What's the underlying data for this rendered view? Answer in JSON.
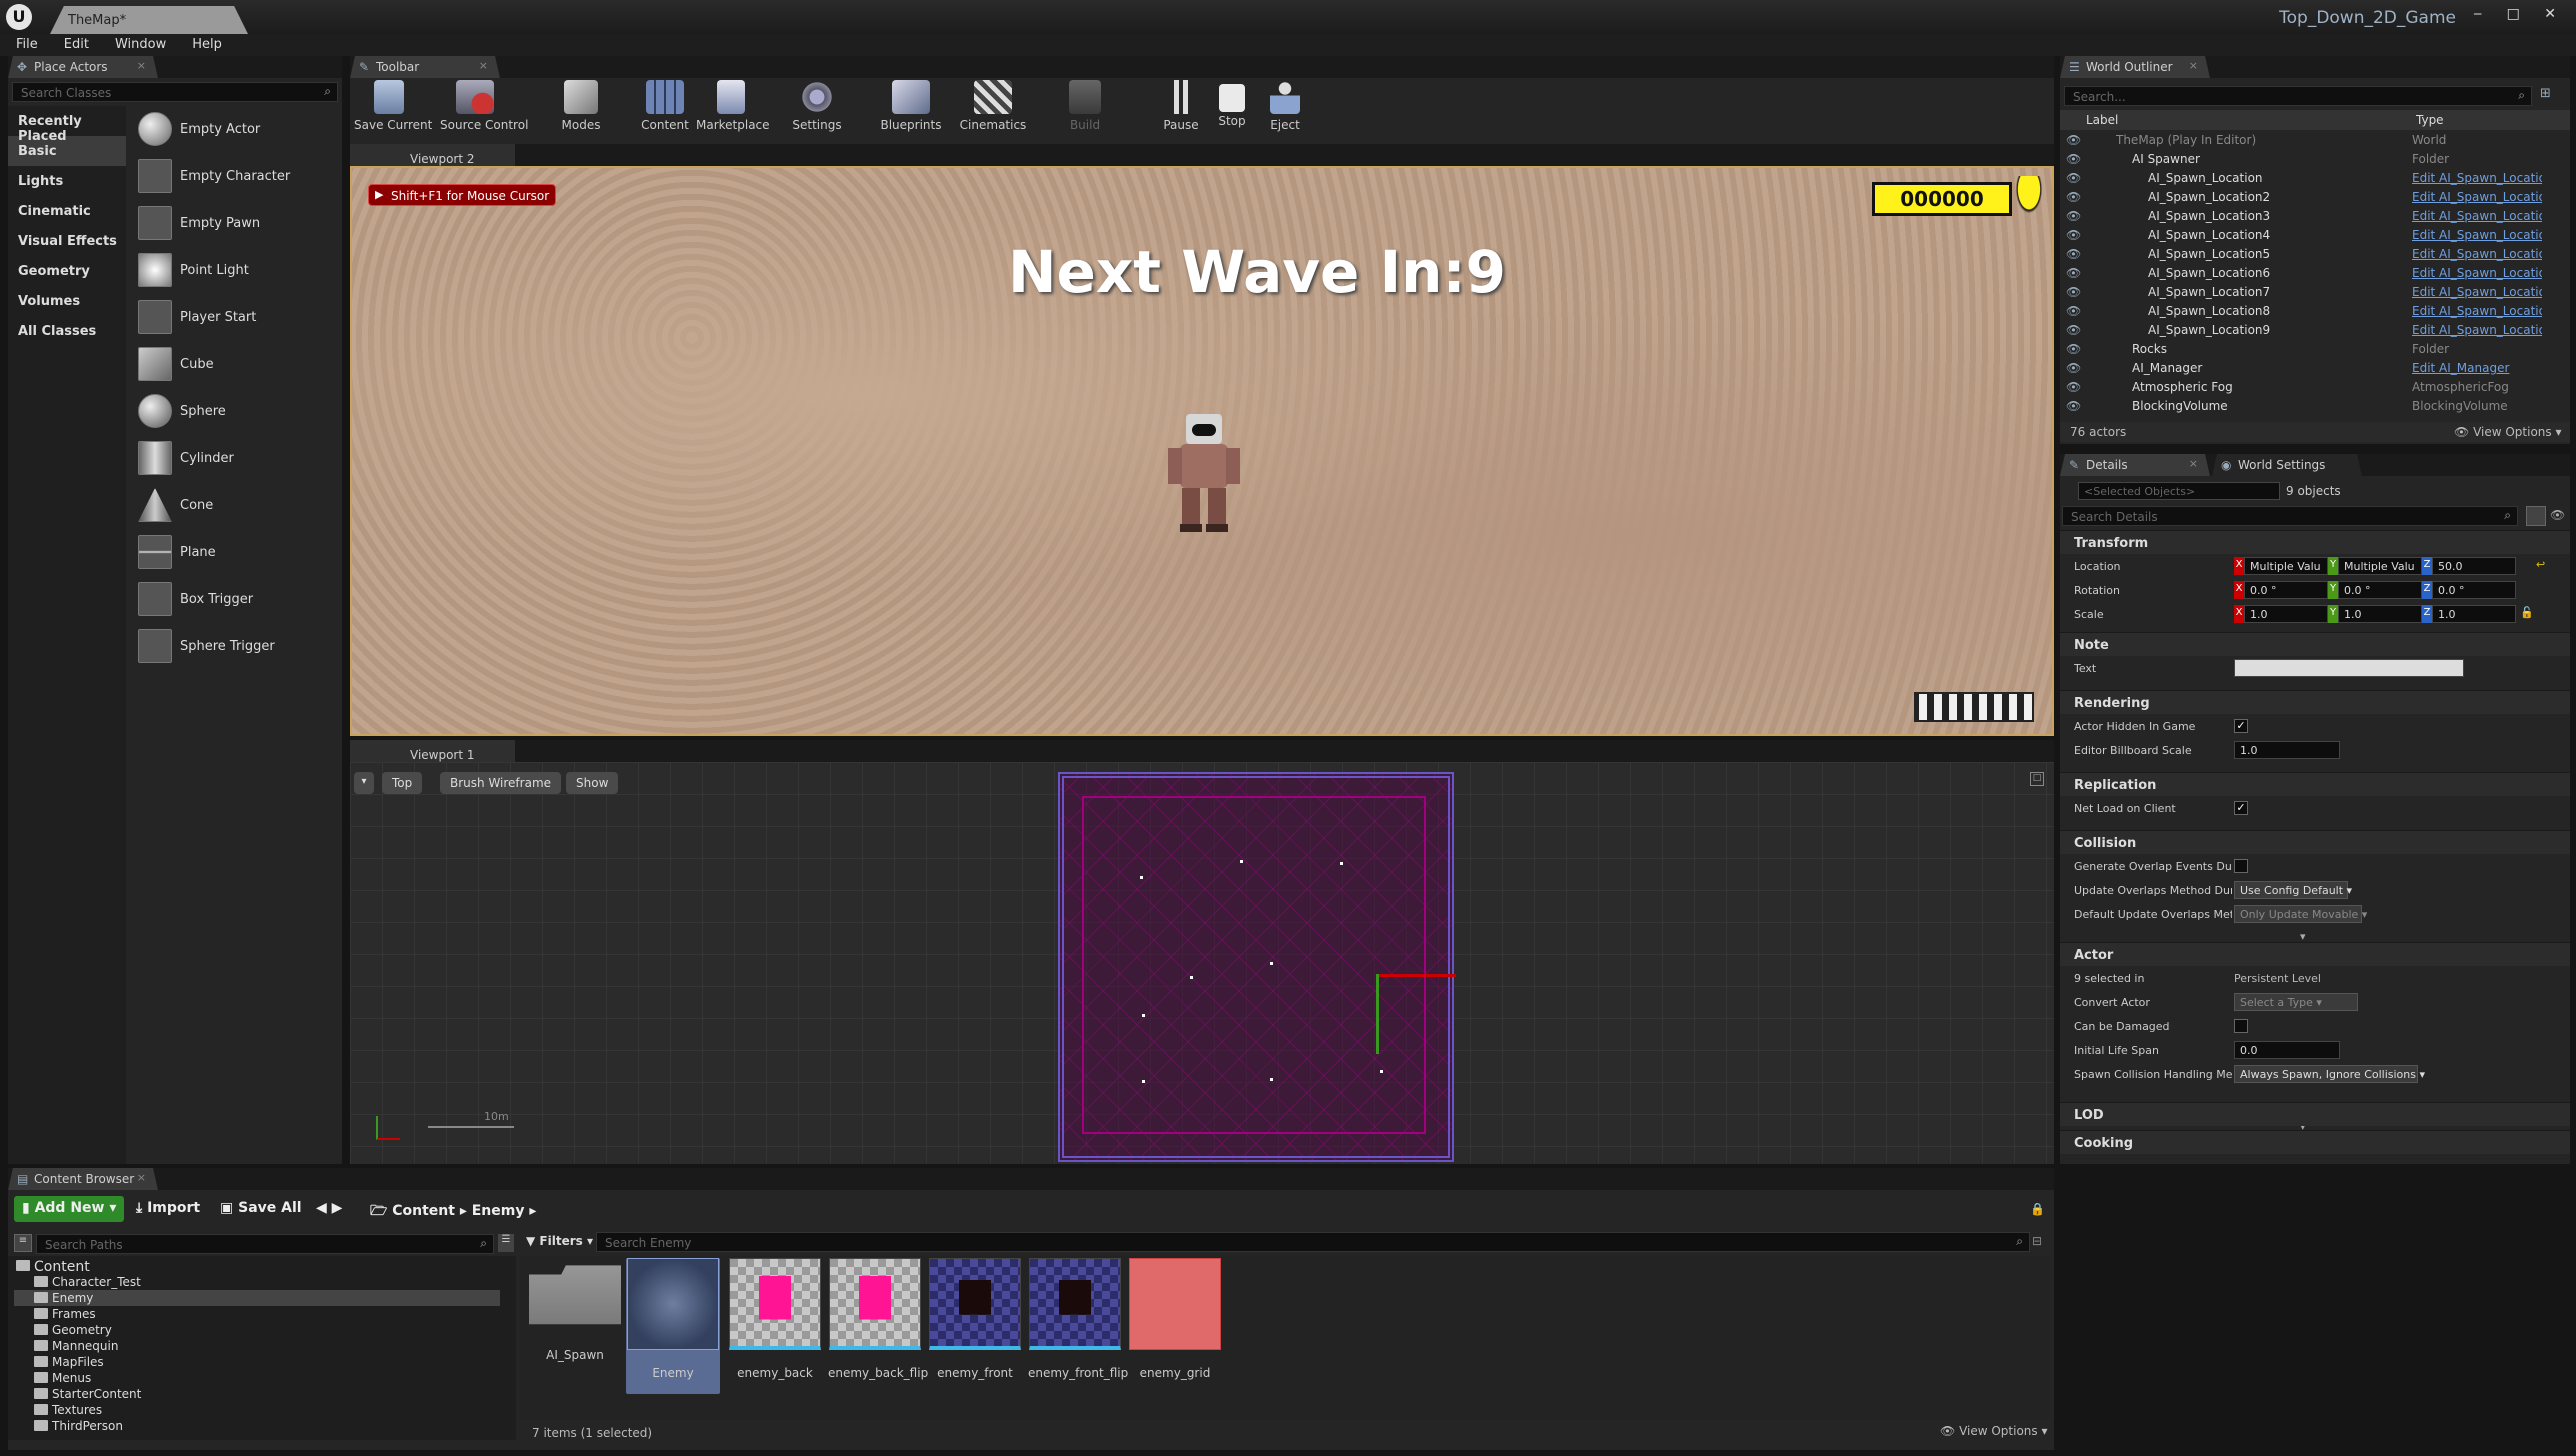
{
  "window": {
    "doc_tab": "TheMap*",
    "game_title": "Top_Down_2D_Game",
    "controls": "‒ □ ✕"
  },
  "menu": [
    "File",
    "Edit",
    "Window",
    "Help"
  ],
  "place_actors": {
    "tab": "Place Actors",
    "search_placeholder": "Search Classes",
    "categories": [
      "Recently Placed",
      "Basic",
      "Lights",
      "Cinematic",
      "Visual Effects",
      "Geometry",
      "Volumes",
      "All Classes"
    ],
    "selected_category": "Basic",
    "items": [
      "Empty Actor",
      "Empty Character",
      "Empty Pawn",
      "Point Light",
      "Player Start",
      "Cube",
      "Sphere",
      "Cylinder",
      "Cone",
      "Plane",
      "Box Trigger",
      "Sphere Trigger"
    ]
  },
  "toolbar": {
    "tab": "Toolbar",
    "buttons": [
      "Save Current",
      "Source Control",
      "Modes",
      "Content",
      "Marketplace",
      "Settings",
      "Blueprints",
      "Cinematics",
      "Build",
      "Pause",
      "Stop",
      "Eject"
    ]
  },
  "viewport2": {
    "tab": "Viewport 2",
    "hint": "Shift+F1 for Mouse Cursor",
    "score": "000000",
    "wave_text": "Next Wave In:9"
  },
  "viewport1": {
    "tab": "Viewport 1",
    "view_mode": "Top",
    "render_mode": "Brush Wireframe",
    "show": "Show",
    "scale": "10m"
  },
  "outliner": {
    "tab": "World Outliner",
    "search_placeholder": "Search...",
    "col_label": "Label",
    "col_type": "Type",
    "rows": [
      {
        "label": "TheMap (Play In Editor)",
        "type": "World",
        "link": false,
        "indent": 0
      },
      {
        "label": "AI Spawner",
        "type": "Folder",
        "link": false,
        "indent": 1
      },
      {
        "label": "AI_Spawn_Location",
        "type": "Edit AI_Spawn_Locatio",
        "link": true,
        "indent": 2
      },
      {
        "label": "AI_Spawn_Location2",
        "type": "Edit AI_Spawn_Locatio",
        "link": true,
        "indent": 2
      },
      {
        "label": "AI_Spawn_Location3",
        "type": "Edit AI_Spawn_Locatio",
        "link": true,
        "indent": 2
      },
      {
        "label": "AI_Spawn_Location4",
        "type": "Edit AI_Spawn_Locatio",
        "link": true,
        "indent": 2
      },
      {
        "label": "AI_Spawn_Location5",
        "type": "Edit AI_Spawn_Locatio",
        "link": true,
        "indent": 2
      },
      {
        "label": "AI_Spawn_Location6",
        "type": "Edit AI_Spawn_Locatio",
        "link": true,
        "indent": 2
      },
      {
        "label": "AI_Spawn_Location7",
        "type": "Edit AI_Spawn_Locatio",
        "link": true,
        "indent": 2
      },
      {
        "label": "AI_Spawn_Location8",
        "type": "Edit AI_Spawn_Locatio",
        "link": true,
        "indent": 2
      },
      {
        "label": "AI_Spawn_Location9",
        "type": "Edit AI_Spawn_Locatio",
        "link": true,
        "indent": 2
      },
      {
        "label": "Rocks",
        "type": "Folder",
        "link": false,
        "indent": 1
      },
      {
        "label": "AI_Manager",
        "type": "Edit AI_Manager",
        "link": true,
        "indent": 1
      },
      {
        "label": "Atmospheric Fog",
        "type": "AtmosphericFog",
        "link": false,
        "indent": 1
      },
      {
        "label": "BlockingVolume",
        "type": "BlockingVolume",
        "link": false,
        "indent": 1
      }
    ],
    "actor_count": "76 actors",
    "view_options": "View Options"
  },
  "details": {
    "tab": "Details",
    "tab2": "World Settings",
    "selected_placeholder": "<Selected Objects>",
    "objects": "9 objects",
    "search_placeholder": "Search Details",
    "transform": {
      "title": "Transform",
      "location_label": "Location",
      "rotation_label": "Rotation",
      "scale_label": "Scale",
      "location": [
        "Multiple Valu",
        "Multiple Valu",
        "50.0"
      ],
      "rotation": [
        "0.0 °",
        "0.0 °",
        "0.0 °"
      ],
      "scale": [
        "1.0",
        "1.0",
        "1.0"
      ]
    },
    "note": {
      "title": "Note",
      "text_label": "Text"
    },
    "rendering": {
      "title": "Rendering",
      "hidden_label": "Actor Hidden In Game",
      "billboard_label": "Editor Billboard Scale",
      "billboard_value": "1.0"
    },
    "replication": {
      "title": "Replication",
      "net_load_label": "Net Load on Client"
    },
    "collision": {
      "title": "Collision",
      "gen_overlap_label": "Generate Overlap Events During",
      "update_method_label": "Update Overlaps Method During",
      "update_method_value": "Use Config Default",
      "default_update_label": "Default Update Overlaps Metho",
      "default_update_value": "Only Update Movable"
    },
    "actor": {
      "title": "Actor",
      "selected_label": "9 selected in",
      "selected_value": "Persistent Level",
      "convert_label": "Convert Actor",
      "convert_value": "Select a Type",
      "damaged_label": "Can be Damaged",
      "lifespan_label": "Initial Life Span",
      "lifespan_value": "0.0",
      "spawn_label": "Spawn Collision Handling Meth",
      "spawn_value": "Always Spawn, Ignore Collisions"
    },
    "lod": "LOD",
    "cooking": "Cooking"
  },
  "content_browser": {
    "tab": "Content Browser",
    "add_new": "Add New",
    "import": "Import",
    "save_all": "Save All",
    "path": [
      "Content",
      "Enemy"
    ],
    "search_paths": "Search Paths",
    "filters": "Filters",
    "search_assets": "Search Enemy",
    "tree": [
      "Content",
      "Character_Test",
      "Enemy",
      "Frames",
      "Geometry",
      "Mannequin",
      "MapFiles",
      "Menus",
      "StarterContent",
      "Textures",
      "ThirdPerson"
    ],
    "assets": [
      "AI_Spawn",
      "Enemy",
      "enemy_back",
      "enemy_back_flip",
      "enemy_front",
      "enemy_front_flip",
      "enemy_grid"
    ],
    "status": "7 items (1 selected)",
    "view_options": "View Options"
  }
}
